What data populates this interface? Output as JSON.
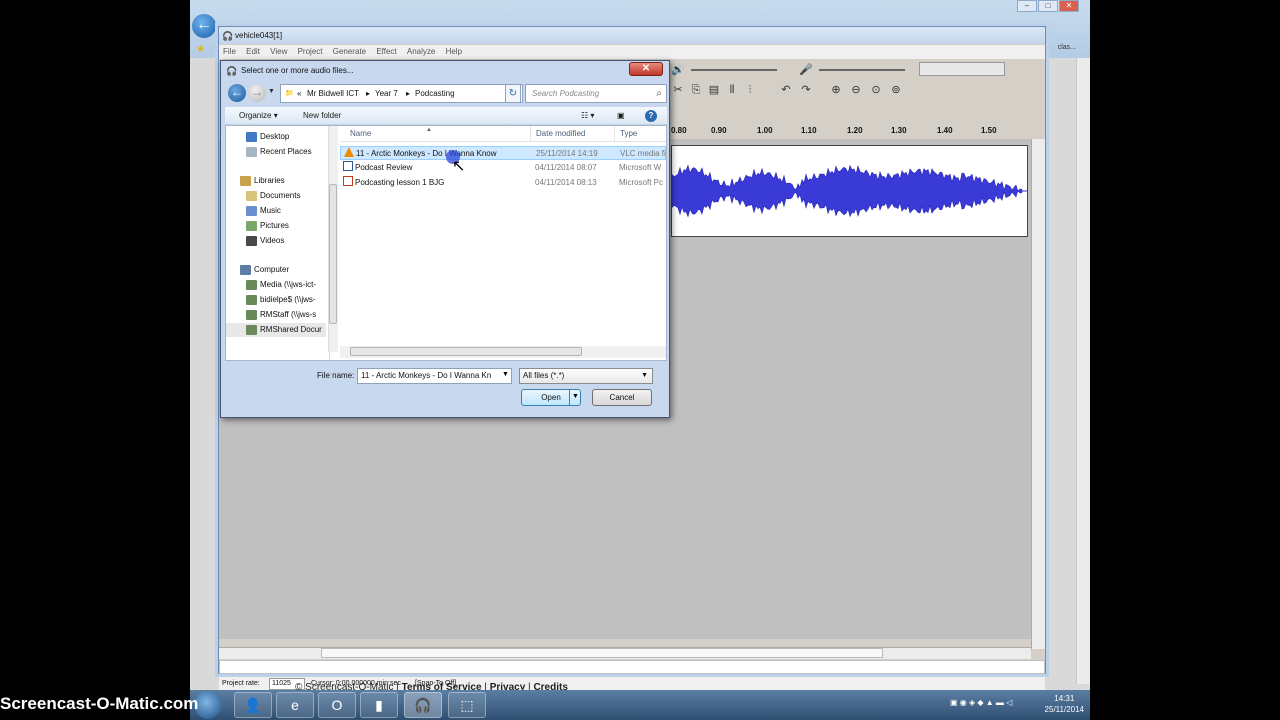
{
  "watermark": "Screencast-O-Matic.com",
  "footer": {
    "copyright": "© Screencast-O-Matic",
    "links": [
      "Terms of Service",
      "Privacy",
      "Credits"
    ]
  },
  "browser": {
    "right_label": "clas..."
  },
  "audacity": {
    "window_title": "vehicle043[1]",
    "menu": [
      "File",
      "Edit",
      "View",
      "Project",
      "Generate",
      "Effect",
      "Analyze",
      "Help"
    ],
    "ruler_ticks": [
      "0.80",
      "0.90",
      "1.00",
      "1.10",
      "1.20",
      "1.30",
      "1.40",
      "1.50"
    ],
    "status": {
      "project_rate_label": "Project rate:",
      "project_rate_value": "11025",
      "cursor_text": "Cursor: 0:00.000000 min:sec",
      "snap_text": "[Snap-To Off]"
    }
  },
  "dialog": {
    "title": "Select one or more audio files...",
    "breadcrumb": [
      "«",
      "Mr Bidwell ICT",
      "Year 7",
      "Podcasting"
    ],
    "search_placeholder": "Search Podcasting",
    "toolbar": {
      "organize": "Organize",
      "new_folder": "New folder"
    },
    "nav": {
      "favorites": [
        "Desktop",
        "Recent Places"
      ],
      "libraries_label": "Libraries",
      "libraries": [
        "Documents",
        "Music",
        "Pictures",
        "Videos"
      ],
      "computer_label": "Computer",
      "drives": [
        "Media (\\\\jws-ict-",
        "bidielpe$ (\\\\jws-",
        "RMStaff (\\\\jws-s",
        "RMShared Docur"
      ]
    },
    "columns": {
      "name": "Name",
      "date": "Date modified",
      "type": "Type"
    },
    "files": [
      {
        "name": "11 - Arctic Monkeys - Do I Wanna Know",
        "date": "25/11/2014 14:19",
        "type": "VLC media fi",
        "icon": "vlc-icon",
        "selected": true
      },
      {
        "name": "Podcast Review",
        "date": "04/11/2014 08:07",
        "type": "Microsoft W",
        "icon": "word-doc-icon",
        "selected": false
      },
      {
        "name": "Podcasting lesson 1 BJG",
        "date": "04/11/2014 08:13",
        "type": "Microsoft Pc",
        "icon": "powerpoint-icon",
        "selected": false
      }
    ],
    "file_name_label": "File name:",
    "file_name_value": "11 - Arctic Monkeys - Do I Wanna Kn",
    "filter": "All files (*.*)",
    "open_label": "Open",
    "cancel_label": "Cancel"
  },
  "taskbar": {
    "clock_time": "14:31",
    "clock_date": "25/11/2014",
    "apps": [
      "user-icon",
      "ie-icon",
      "outlook-icon",
      "fileshare-icon",
      "audacity-icon",
      "snip-icon"
    ]
  }
}
